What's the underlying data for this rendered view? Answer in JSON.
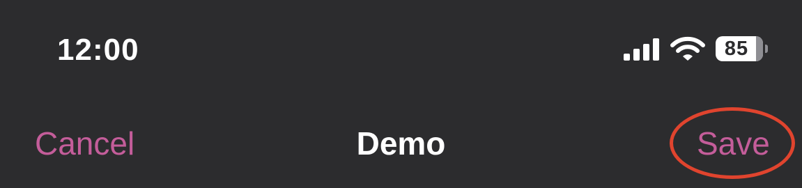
{
  "status_bar": {
    "time": "12:00",
    "signal_icon": "cellular-signal-icon",
    "wifi_icon": "wifi-icon",
    "battery_level": "85",
    "battery_fraction": 0.85
  },
  "nav_bar": {
    "cancel_label": "Cancel",
    "title": "Demo",
    "save_label": "Save"
  },
  "colors": {
    "background": "#2c2c2e",
    "accent": "#c45d9a",
    "title_text": "#ffffff",
    "highlight_ring": "#e0442e"
  }
}
